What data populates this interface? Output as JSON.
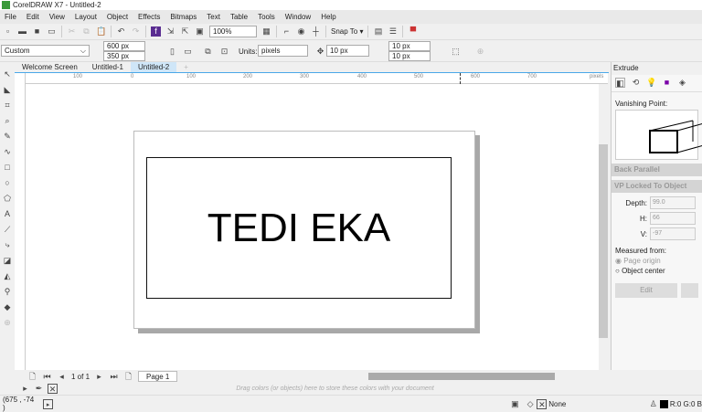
{
  "app": {
    "title": "CorelDRAW X7 - Untitled-2"
  },
  "menu": [
    "File",
    "Edit",
    "View",
    "Layout",
    "Object",
    "Effects",
    "Bitmaps",
    "Text",
    "Table",
    "Tools",
    "Window",
    "Help"
  ],
  "toolbar": {
    "zoom": "100%",
    "snap_to": "Snap To"
  },
  "propbar": {
    "preset": "Custom",
    "width": "600 px",
    "height": "350 px",
    "units_label": "Units:",
    "units": "pixels",
    "nudge": "10 px",
    "dup_x": "10 px",
    "dup_y": "10 px"
  },
  "tabs": [
    "Welcome Screen",
    "Untitled-1",
    "Untitled-2"
  ],
  "ruler": {
    "labels": [
      "100",
      "0",
      "100",
      "200",
      "300",
      "400",
      "500",
      "600",
      "700"
    ],
    "unit": "pixels"
  },
  "canvas": {
    "text": "TEDI EKA"
  },
  "pagenav": {
    "count": "1 of 1",
    "page_tab": "Page 1"
  },
  "palette": {
    "hint": "Drag colors (or objects) here to store these colors with your document"
  },
  "status": {
    "coords": "(675 , -74 )",
    "fill": "None",
    "outline": "R:0 G:0 B"
  },
  "docker": {
    "title": "Extrude",
    "vanishing_point": "Vanishing Point:",
    "back_parallel": "Back Parallel",
    "vp_locked": "VP Locked To Object",
    "depth_label": "Depth:",
    "depth": "99.0",
    "h_label": "H:",
    "h": "66",
    "v_label": "V:",
    "v": "-97",
    "measured_from": "Measured from:",
    "page_origin": "Page origin",
    "object_center": "Object center",
    "edit": "Edit"
  }
}
